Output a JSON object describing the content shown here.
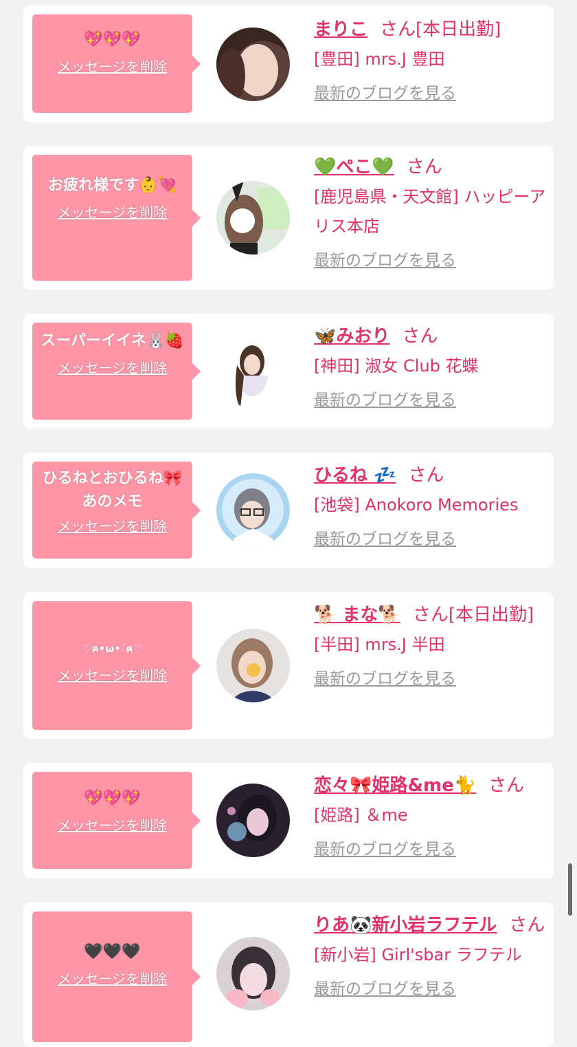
{
  "cards": [
    {
      "message": "💖💖💖",
      "delete_label": "メッセージを削除",
      "name": "まりこ",
      "san": "さん",
      "status": "[本日出勤]",
      "shop": "[豊田] mrs.J 豊田",
      "blog_label": "最新のブログを見る"
    },
    {
      "message": "お疲れ様です👶💘",
      "delete_label": "メッセージを削除",
      "name": "💚ぺこ💚",
      "san": "さん",
      "status": "",
      "shop": "[鹿児島県・天文館] ハッピーアリス本店",
      "blog_label": "最新のブログを見る"
    },
    {
      "message": "スーパーイイネ🐰🍓",
      "delete_label": "メッセージを削除",
      "name": "🦋みおり",
      "san": "さん",
      "status": "",
      "shop": "[神田] 淑女 Club 花蝶",
      "blog_label": "最新のブログを見る"
    },
    {
      "message": "ひるねとおひるね🎀あのメモ",
      "delete_label": "メッセージを削除",
      "name": "ひるね 💤",
      "san": "さん",
      "status": "",
      "shop": "[池袋] Anokoro Memories",
      "blog_label": "最新のブログを見る"
    },
    {
      "message": "♡ฅ•ω•´ฅ♡",
      "delete_label": "メッセージを削除",
      "name": "🐕 まな🐕",
      "san": "さん",
      "status": "[本日出勤]",
      "shop": "[半田] mrs.J 半田",
      "blog_label": "最新のブログを見る"
    },
    {
      "message": "💖💖💖",
      "delete_label": "メッセージを削除",
      "name": "恋々🎀姫路&me🐈",
      "san": "さん",
      "status": "",
      "shop": "[姫路] ＆me",
      "blog_label": "最新のブログを見る"
    },
    {
      "message": "🖤🖤🖤",
      "delete_label": "メッセージを削除",
      "name": "りあ🐼新小岩ラフテル",
      "san": "さん",
      "status": "",
      "shop": "[新小岩] Girl'sbar ラフテル",
      "blog_label": "最新のブログを見る"
    }
  ],
  "colors": {
    "bubble": "#fe96a7",
    "accent": "#e23069",
    "muted": "#999999",
    "background": "#f2f2f2"
  }
}
